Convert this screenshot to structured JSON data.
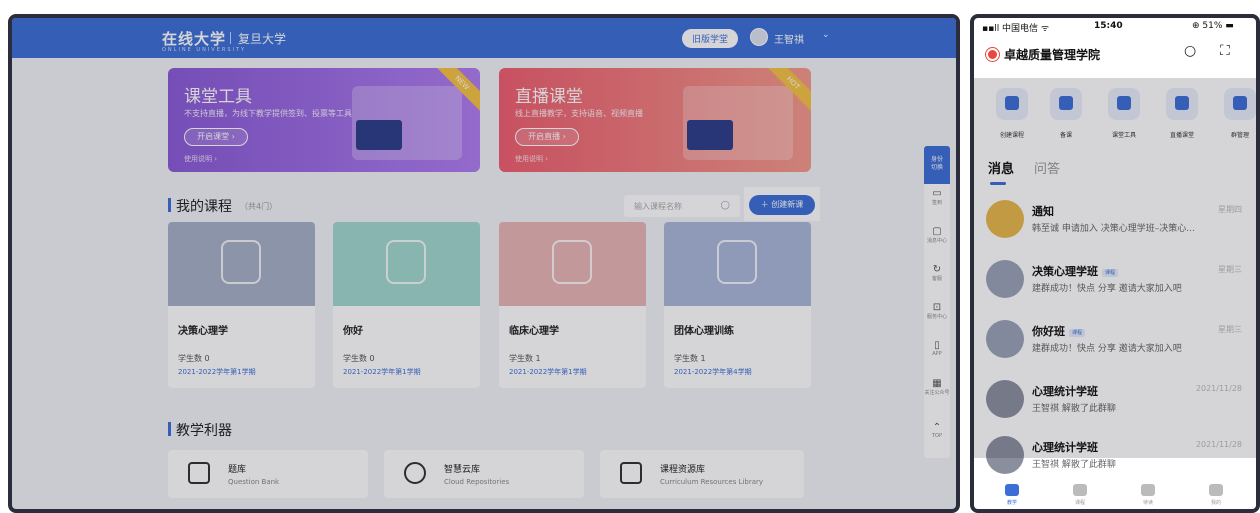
{
  "desktop": {
    "header": {
      "logo": "在线大学",
      "logo_sub": "ONLINE UNIVERSITY",
      "school": "复旦大学",
      "old_version": "旧版学堂",
      "user_name": "王智祺",
      "user_chevron": "⌄"
    },
    "banners": [
      {
        "title": "课堂工具",
        "subtitle": "不支持直播，为线下教学提供签到、投票等工具",
        "button": "开启课堂 ›",
        "help": "使用说明 ›",
        "badge": "NEW"
      },
      {
        "title": "直播课堂",
        "subtitle": "线上直播教学，支持语音、视频直播",
        "button": "开启直播 ›",
        "help": "使用说明 ›",
        "badge": "HOT"
      }
    ],
    "my_courses": {
      "title": "我的课程",
      "count": "（共4门）",
      "search_placeholder": "输入课程名称",
      "search_icon": "○",
      "create_button": "＋ 创建新课",
      "courses": [
        {
          "name": "决策心理学",
          "students": "学生数 0",
          "term": "2021-2022学年第1学期",
          "color": "#a7b0c6"
        },
        {
          "name": "你好",
          "students": "学生数 0",
          "term": "2021-2022学年第1学期",
          "color": "#a3d8cf"
        },
        {
          "name": "临床心理学",
          "students": "学生数 1",
          "term": "2021-2022学年第1学期",
          "color": "#e8b5b5"
        },
        {
          "name": "团体心理训练",
          "students": "学生数 1",
          "term": "2021-2022学年第4学期",
          "color": "#aab8d8"
        }
      ]
    },
    "tools_section": {
      "title": "教学利器",
      "tools": [
        {
          "name": "题库",
          "sub": "Question Bank"
        },
        {
          "name": "智慧云库",
          "sub": "Cloud Repositories"
        },
        {
          "name": "课程资源库",
          "sub": "Curriculum Resources Library"
        }
      ]
    },
    "rail": {
      "first": "身份\n切换",
      "items": [
        {
          "icon": "▭",
          "label": "签到"
        },
        {
          "icon": "▢",
          "label": "消息中心"
        },
        {
          "icon": "↻",
          "label": "客服"
        },
        {
          "icon": "⊡",
          "label": "服务中心"
        },
        {
          "icon": "▯",
          "label": "APP"
        },
        {
          "icon": "▦",
          "label": "关注公众号"
        },
        {
          "icon": "⌃",
          "label": "TOP"
        }
      ]
    }
  },
  "phone": {
    "status": {
      "carrier": "▪▪ll 中国电信 ᯤ",
      "time": "15:40",
      "battery": "⊕ 51% ▬"
    },
    "app_title": "卓越质量管理学院",
    "header_icons": {
      "search": "○",
      "scan": "⛶"
    },
    "quick": [
      "创建课程",
      "备课",
      "课堂工具",
      "直播课堂",
      "群管理"
    ],
    "tabs": {
      "active": "消息",
      "other": "问答"
    },
    "messages": [
      {
        "title": "通知",
        "tag": "",
        "sub": "韩至诚 申请加入 决策心理学班–决策心...",
        "time": "星期四",
        "color": "#e8b84a"
      },
      {
        "title": "决策心理学班",
        "tag": "课程",
        "sub": "建群成功！快点 分享 邀请大家加入吧",
        "time": "星期三",
        "color": "#9aa3b8"
      },
      {
        "title": "你好班",
        "tag": "课程",
        "sub": "建群成功！快点 分享 邀请大家加入吧",
        "time": "星期三",
        "color": "#9aa3b8"
      },
      {
        "title": "心理统计学班",
        "tag": "",
        "sub": "王智祺 解散了此群聊",
        "time": "2021/11/28",
        "color": "#8a8f9e"
      },
      {
        "title": "心理统计学班",
        "tag": "",
        "sub": "王智祺 解散了此群聊",
        "time": "2021/11/28",
        "color": "#8a8f9e"
      }
    ],
    "nav": [
      "教学",
      "课程",
      "待读",
      "我的"
    ]
  }
}
